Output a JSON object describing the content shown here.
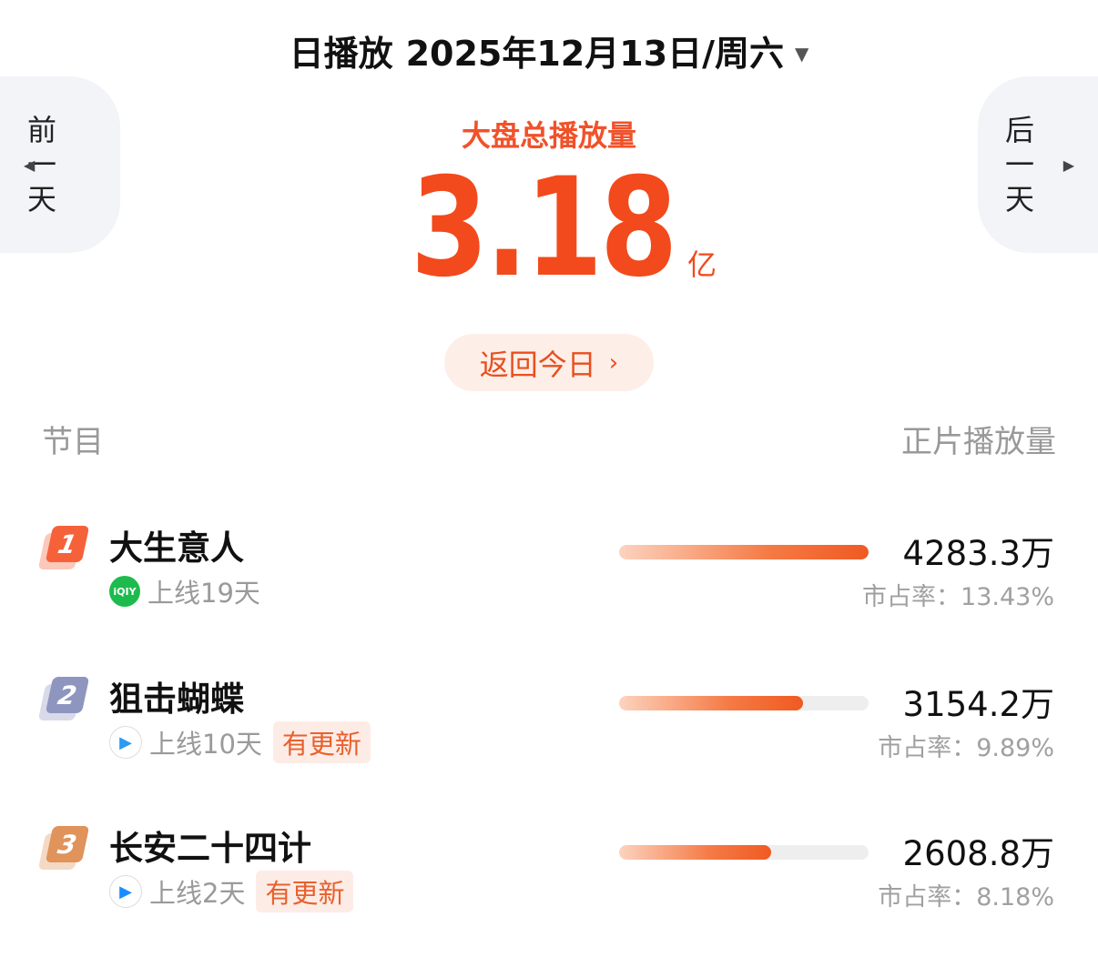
{
  "header": {
    "mode": "日播放",
    "date": "2025年12月13日/周六"
  },
  "nav": {
    "prev": [
      "前",
      "一",
      "天"
    ],
    "next": [
      "后",
      "一",
      "天"
    ]
  },
  "summary": {
    "label": "大盘总播放量",
    "value": "3.18",
    "unit": "亿",
    "back_today": "返回今日"
  },
  "columns": {
    "left": "节目",
    "right": "正片播放量"
  },
  "colors": {
    "accent": "#f24a1c",
    "rank1": "#f5623a",
    "rank2": "#8e96bf",
    "rank3": "#e0935a"
  },
  "rows": [
    {
      "rank": "1",
      "title": "大生意人",
      "platform": "iqiyi-icon",
      "platform_text": "iQIY",
      "online": "上线19天",
      "tag": "",
      "plays": "4283.3万",
      "share": "市占率：13.43%",
      "bar_fraction": 1.0
    },
    {
      "rank": "2",
      "title": "狙击蝴蝶",
      "platform": "tencent-video-icon",
      "platform_text": "",
      "online": "上线10天",
      "tag": "有更新",
      "plays": "3154.2万",
      "share": "市占率：9.89%",
      "bar_fraction": 0.736
    },
    {
      "rank": "3",
      "title": "长安二十四计",
      "platform": "youku-icon",
      "platform_text": "",
      "online": "上线2天",
      "tag": "有更新",
      "plays": "2608.8万",
      "share": "市占率：8.18%",
      "bar_fraction": 0.609
    }
  ]
}
